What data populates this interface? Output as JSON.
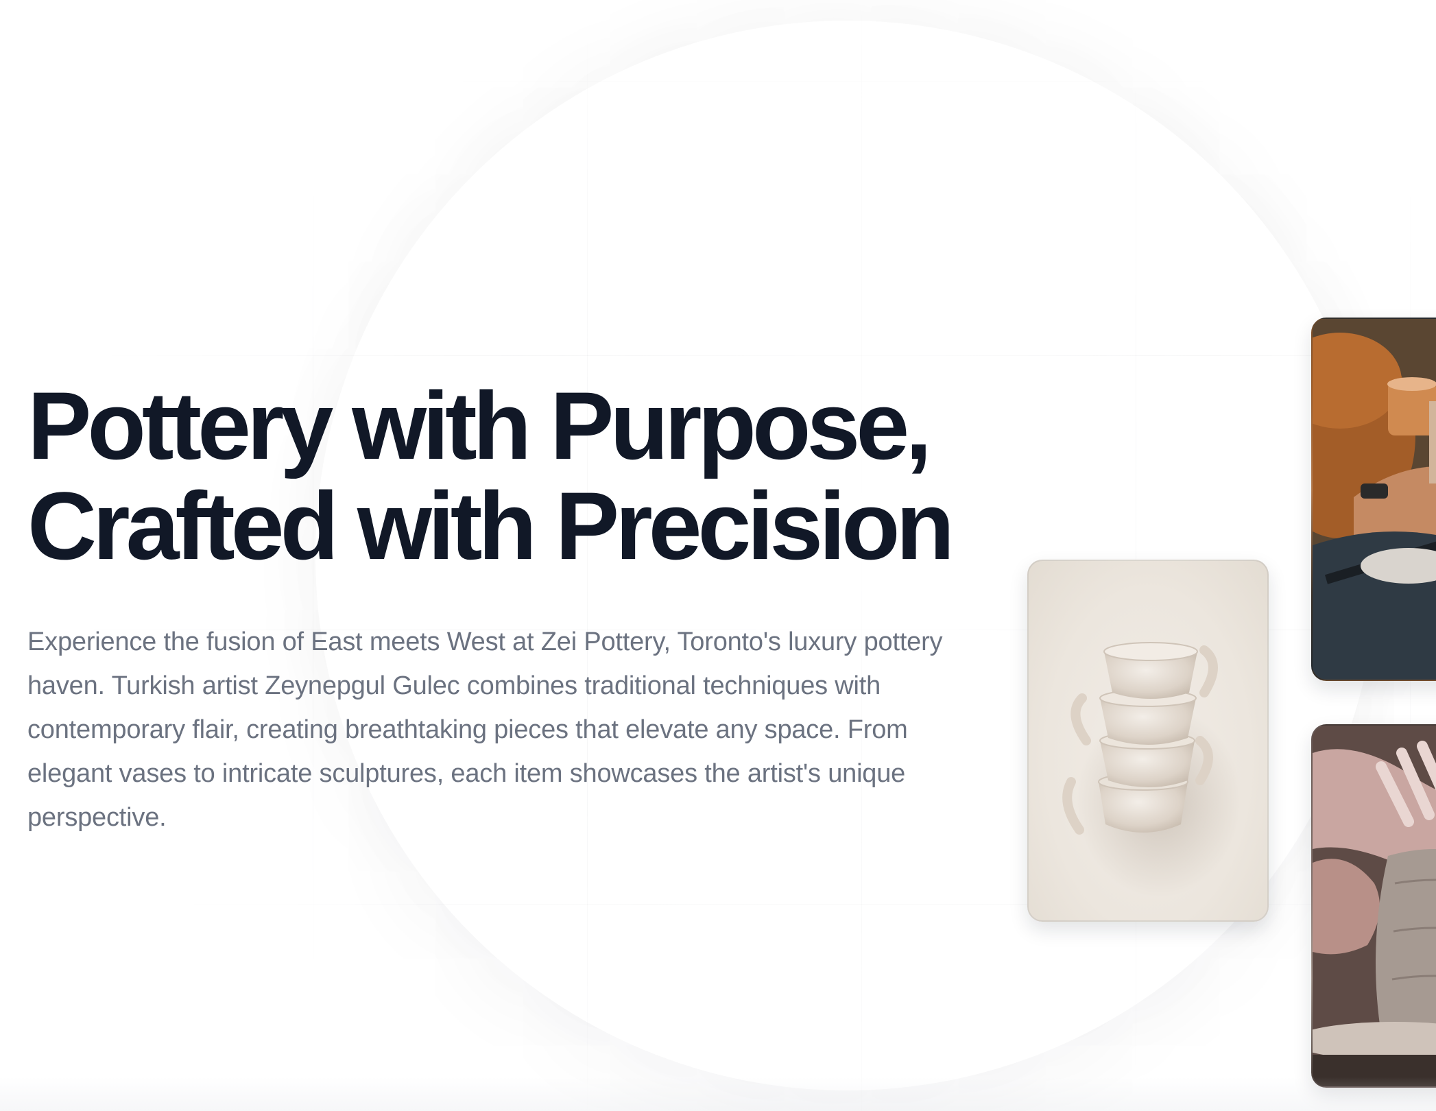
{
  "hero": {
    "title_line1": "Pottery with Purpose,",
    "title_line2": "Crafted with Precision",
    "description": "Experience the fusion of East meets West at Zei Pottery, Toronto's luxury pottery haven. Turkish artist Zeynepgul Gulec combines traditional techniques with contemporary flair, creating breathtaking pieces that elevate any space. From elegant vases to intricate sculptures, each item showcases the artist's unique perspective."
  },
  "gallery": {
    "images": [
      {
        "subject": "stacked-ceramic-cups",
        "accent": "#ece6de"
      },
      {
        "subject": "artist-shaping-clay",
        "accent": "#a4612b"
      },
      {
        "subject": "hands-on-pottery-wheel",
        "accent": "#b3a49a"
      }
    ]
  },
  "colors": {
    "heading": "#111827",
    "body_text": "#6b7280",
    "background": "#ffffff"
  }
}
